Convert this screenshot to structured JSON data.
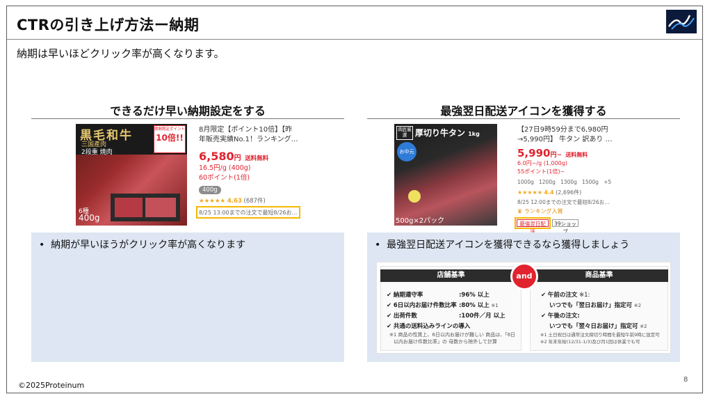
{
  "slide": {
    "title": "CTRの引き上げ方法ー納期",
    "subtitle": "納期は早いほどクリック率が高くなります。",
    "footer": "©2025Proteinum",
    "page_number": "8"
  },
  "left": {
    "heading": "できるだけ早い納期設定をする",
    "image_caption": {
      "line1": "黒毛和牛",
      "line2": "三国產肉",
      "line3": "2段重 焼肉",
      "badge_top": "期間限定ポイント",
      "badge_main": "10倍!!",
      "corner": "6種",
      "weight": "400g"
    },
    "product": {
      "title_line1": "8月限定【ポイント10倍】【昨",
      "title_line2": "年販売実績No.1！ランキング…",
      "price": "6,580",
      "price_unit": "円",
      "shipping": "送料無料",
      "unit_price": "16.5円/g (400g)",
      "points": "60ポイント(1倍)",
      "tag": "400g",
      "rating": "4.63",
      "reviews": "(687件)",
      "delivery": "8/25 13:00までの注文で最短8/26お…"
    },
    "bullet": "納期が早いほうがクリック率が高くなります"
  },
  "right": {
    "heading": "最強翌日配送アイコンを獲得する",
    "image_caption": {
      "tag": "肉匠厳選",
      "title": "厚切り牛タン",
      "unit": "1kg",
      "badge": "お中元",
      "bottom": "500g×2パック"
    },
    "product": {
      "title_line1": "【27日9時59分まで6,980円",
      "title_line2": "→5,990円】 牛タン 訳あり …",
      "price": "5,990",
      "price_unit": "円~",
      "shipping": "送料無料",
      "unit_price": "6.0円~/g (1,000g)",
      "points": "55ポイント(1倍)~",
      "options": [
        "1000g",
        "1200g",
        "1300g",
        "1500g",
        "+5"
      ],
      "rating": "4.4",
      "reviews": "(2,696件)",
      "delivery": "8/25 12:00までの注文で最短8/26お…",
      "ranking": "ランキング入賞",
      "badge_fast": "最強翌日配送",
      "badge_shop": "39ショップ"
    },
    "bullet": "最強翌日配送アイコンを獲得できるなら獲得しましょう",
    "criteria": {
      "store_head": "店舗基準",
      "product_head": "商品基準",
      "and": "and",
      "store_rows": [
        {
          "label": "納期遵守率",
          "value": ":96% 以上",
          "note": ""
        },
        {
          "label": "6日以内お届け件数比率",
          "value": ":80% 以上",
          "note": "※1"
        },
        {
          "label": "出荷件数",
          "value": ":100件／月 以上",
          "note": ""
        },
        {
          "label": "共通の送料込みラインの導入",
          "value": "",
          "note": ""
        }
      ],
      "store_note1": "※1 商品の性質上、6日以内お届けが難しい 商品は、「6日",
      "store_note2": "以内お届け件数比率」の 母数から除外して計算",
      "product_rows": [
        {
          "label": "午前の注文",
          "note": "※1:"
        },
        {
          "label": "いつでも「翌日お届け」指定可",
          "note": "※2"
        },
        {
          "label": "午後の注文:",
          "note": ""
        },
        {
          "label": "いつでも「翌々日お届け」指定可",
          "note": "※2"
        }
      ],
      "product_note1": "※1 土日祝日は通常注文締切り時間を最短午前9時に設定可",
      "product_note2": "※2 年末年始(12/31-1/3)及び月1回は休業でも可"
    }
  },
  "colors": {
    "accent_red": "#e0232e",
    "highlight_yellow": "#f5b800",
    "blue_box": "#dde6f2"
  }
}
